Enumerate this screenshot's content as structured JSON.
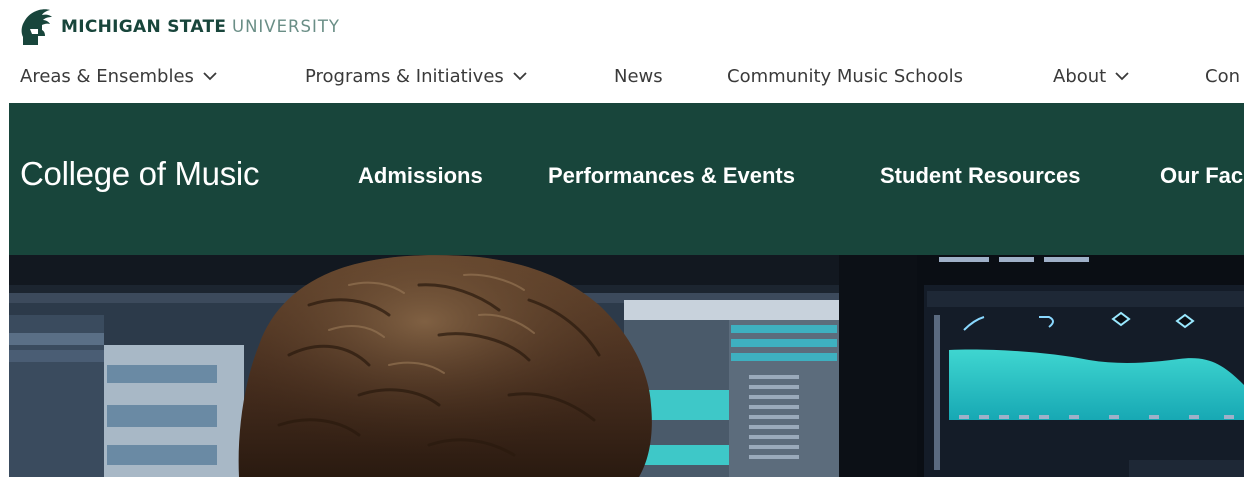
{
  "brand": {
    "name_bold": "MICHIGAN STATE",
    "name_light": "UNIVERSITY",
    "logo_icon": "spartan-helmet-icon",
    "color": "#18453b"
  },
  "utility_nav": {
    "items": [
      {
        "label": "Areas & Ensembles",
        "has_dropdown": true
      },
      {
        "label": "Programs & Initiatives",
        "has_dropdown": true
      },
      {
        "label": "News",
        "has_dropdown": false
      },
      {
        "label": "Community Music Schools",
        "has_dropdown": false
      },
      {
        "label": "About",
        "has_dropdown": true
      },
      {
        "label": "Con",
        "has_dropdown": false
      }
    ],
    "dropdown_icon": "chevron-down-icon"
  },
  "college": {
    "title": "College of Music",
    "nav": [
      {
        "label": "Admissions"
      },
      {
        "label": "Performances & Events"
      },
      {
        "label": "Student Resources"
      },
      {
        "label": "Our Fac"
      }
    ],
    "background_color": "#18453b"
  },
  "hero": {
    "image_subject": "student-at-music-production-workstation"
  }
}
